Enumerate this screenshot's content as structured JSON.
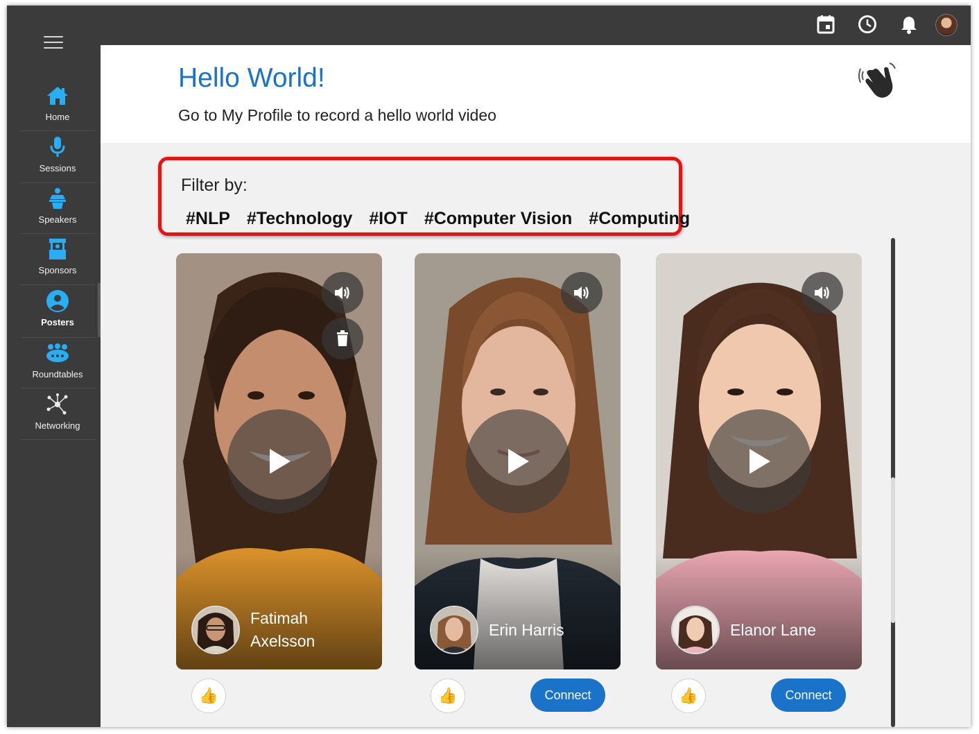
{
  "sidebar": {
    "items": [
      {
        "label": "Home",
        "icon": "home-icon"
      },
      {
        "label": "Sessions",
        "icon": "microphone-icon"
      },
      {
        "label": "Speakers",
        "icon": "podium-icon"
      },
      {
        "label": "Sponsors",
        "icon": "booth-icon"
      },
      {
        "label": "Posters",
        "icon": "user-circle-icon",
        "active": true
      },
      {
        "label": "Roundtables",
        "icon": "people-group-icon"
      },
      {
        "label": "Networking",
        "icon": "network-icon"
      }
    ],
    "accent": "#29aef4"
  },
  "topbar": {
    "icons": [
      "calendar-icon",
      "clock-icon",
      "bell-icon",
      "profile-avatar"
    ]
  },
  "welcome": {
    "title": "Hello World!",
    "subtitle": "Go to My Profile to record a hello world video",
    "title_color": "#1a73c8"
  },
  "filter": {
    "label": "Filter by:",
    "tags": [
      "#NLP",
      "#Technology",
      "#IOT",
      "#Computer Vision",
      "#Computing"
    ],
    "highlight_color": "#ef0f0f"
  },
  "cards": [
    {
      "name_line1": "Fatimah",
      "name_line2": "Axelsson",
      "has_delete": true,
      "has_connect": false
    },
    {
      "name_line1": "Erin Harris",
      "name_line2": "",
      "has_delete": false,
      "has_connect": true
    },
    {
      "name_line1": "Elanor Lane",
      "name_line2": "",
      "has_delete": false,
      "has_connect": true
    }
  ],
  "actions": {
    "connect_label": "Connect",
    "primary_color": "#1a73c8"
  }
}
